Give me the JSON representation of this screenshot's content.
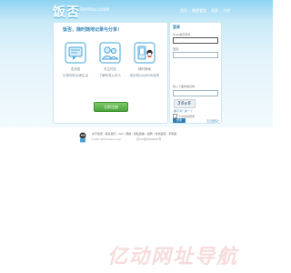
{
  "app": {
    "logo_main": "饭否",
    "logo_sub": "fanfou.com"
  },
  "topnav": {
    "items": [
      "首页",
      "随便看看",
      "搜索",
      "注册"
    ]
  },
  "main": {
    "slogan": "饭否，随时随地记录与分享！",
    "features": [
      {
        "icon": "message-icon",
        "text1": "发消息",
        "text2": "记录你的点滴生活"
      },
      {
        "icon": "friends-icon",
        "text1": "关注好友",
        "text2": "了解你关心的人"
      },
      {
        "icon": "mobile-im-icon",
        "text1": "随时随地",
        "text2": "用手机/QQ/MSN发布"
      }
    ],
    "register_label": "立即注册"
  },
  "login": {
    "title": "登录",
    "username_label": "Email或手机号：",
    "username_value": "",
    "password_label": "密码：",
    "password_value": "",
    "captcha_label": "输入下面的验证码：",
    "captcha_value": "",
    "captcha_text": "36e6",
    "captcha_refresh": "看不清？换一个",
    "remember_label": "下次自动登录",
    "login_button": "登录",
    "forgot_link": "忘记密码？"
  },
  "footer": {
    "links": [
      "关于饭否",
      "联系我们",
      "API",
      "帮助",
      "隐私政策",
      "招聘",
      "友情链接",
      "手机版"
    ],
    "copyright": "© 2007-2025 fanfou.com",
    "icp": "京ICP备09000000号"
  },
  "watermark": {
    "text": "亿动网址导航"
  },
  "colors": {
    "brand": "#3a88b8",
    "header_top": "#8ed2f1",
    "register_green": "#49a43a",
    "login_blue": "#2f7fb8"
  }
}
